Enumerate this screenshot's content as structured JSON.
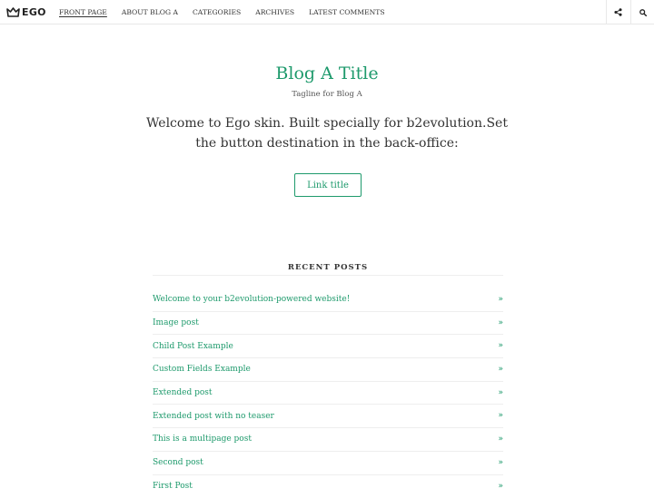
{
  "navbar": {
    "brand": "EGO",
    "menu": [
      {
        "label": "FRONT PAGE",
        "active": true
      },
      {
        "label": "ABOUT BLOG A",
        "active": false
      },
      {
        "label": "CATEGORIES",
        "active": false
      },
      {
        "label": "ARCHIVES",
        "active": false
      },
      {
        "label": "LATEST COMMENTS",
        "active": false
      }
    ],
    "share_icon": "share-icon",
    "search_icon": "search-icon"
  },
  "hero": {
    "title": "Blog A Title",
    "tagline": "Tagline for Blog A",
    "intro": "Welcome to Ego skin. Built specially for b2evolution.Set the button destination in the back-office:",
    "button_label": "Link title"
  },
  "recent_posts": {
    "heading": "RECENT POSTS",
    "items": [
      {
        "title": "Welcome to your b2evolution-powered website!"
      },
      {
        "title": "Image post"
      },
      {
        "title": "Child Post Example"
      },
      {
        "title": "Custom Fields Example"
      },
      {
        "title": "Extended post"
      },
      {
        "title": "Extended post with no teaser"
      },
      {
        "title": "This is a multipage post"
      },
      {
        "title": "Second post"
      },
      {
        "title": "First Post"
      }
    ],
    "arrow_glyph": "»"
  },
  "colors": {
    "accent": "#1e9a6c",
    "text": "#333333",
    "divider": "#eeeeee"
  }
}
